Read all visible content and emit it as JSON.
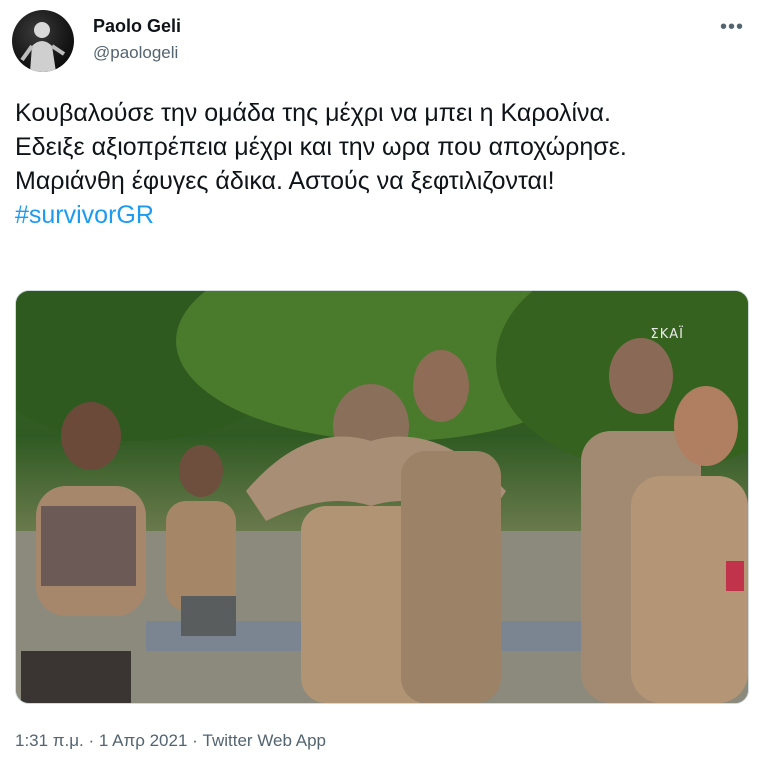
{
  "author": {
    "name": "Paolo Geli",
    "handle": "@paologeli"
  },
  "more_icon": "more-horizontal-icon",
  "tweet": {
    "lines": [
      "Κουβαλούσε την ομάδα της μέχρι να μπει η Καρολίνα.",
      "Εδειξε αξιοπρέπεια μέχρι και την ωρα που αποχώρησε.",
      "Μαριάνθη έφυγες άδικα. Αστούς να ξεφτιλιζονται!"
    ],
    "hashtag": "#survivorGR"
  },
  "media": {
    "watermark": "ΣΚΑΪ"
  },
  "meta": {
    "time": "1:31 π.μ.",
    "sep1": " · ",
    "date": "1 Απρ 2021",
    "sep2": " · ",
    "source": "Twitter Web App"
  },
  "colors": {
    "text": "#0f1419",
    "secondary": "#536471",
    "link": "#1d9bf0"
  }
}
